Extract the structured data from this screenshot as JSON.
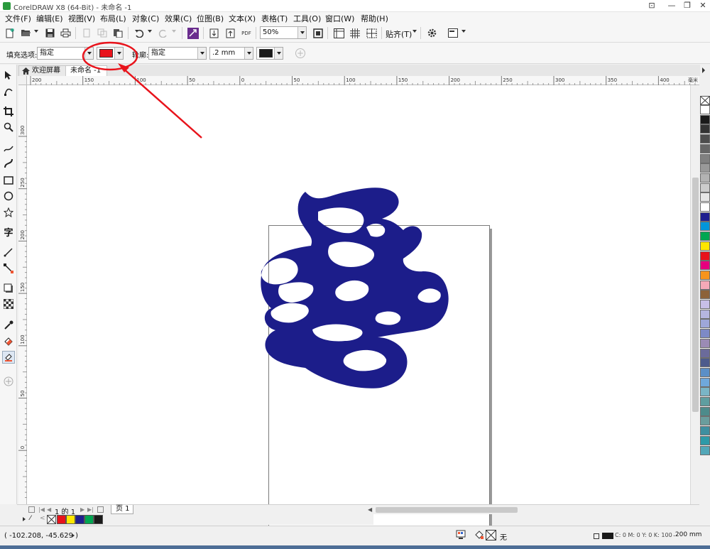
{
  "window": {
    "title": "CorelDRAW X8 (64-Bit) - 未命名 -1",
    "controls": [
      "minimize",
      "restore",
      "close"
    ]
  },
  "menubar": {
    "items": [
      "文件(F)",
      "编辑(E)",
      "视图(V)",
      "布局(L)",
      "对象(C)",
      "效果(C)",
      "位图(B)",
      "文本(X)",
      "表格(T)",
      "工具(O)",
      "窗口(W)",
      "帮助(H)"
    ]
  },
  "toolbar": {
    "zoom_value": "50%",
    "snap_label": "贴齐(T)",
    "pdf_label": "PDF"
  },
  "propbar": {
    "fill_label": "填充选项:",
    "fill_value": "指定",
    "fill_color": "#e8131b",
    "outline_label": "轮廓:",
    "outline_value": "指定",
    "outline_width": ".2 mm",
    "outline_color": "#1a1a1a"
  },
  "tabs": {
    "welcome": "欢迎屏幕",
    "document": "未命名 -1"
  },
  "ruler": {
    "h_ticks": [
      "200",
      "150",
      "100",
      "50",
      "0",
      "50",
      "100",
      "150",
      "200",
      "250",
      "300",
      "350",
      "400"
    ],
    "unit": "毫米",
    "v_ticks": [
      "300",
      "250",
      "200",
      "150",
      "100",
      "50",
      "0"
    ]
  },
  "artwork": {
    "shape_color": "#1c1d8a"
  },
  "palette": {
    "colors": [
      "#ffffff",
      "#1a1a1a",
      "#333333",
      "#4d4d4d",
      "#666666",
      "#808080",
      "#999999",
      "#b3b3b3",
      "#cccccc",
      "#e6e6e6",
      "#ffffff",
      "#1f1f8f",
      "#0095d9",
      "#00a651",
      "#ffe600",
      "#e8131b",
      "#e6007e",
      "#f7941d",
      "#f5a9b8",
      "#8c6239",
      "#c8bfe7",
      "#b5b5e0",
      "#9ea7d9",
      "#7d8ac6",
      "#9b8bb5",
      "#6b6b9b",
      "#4d5b8c",
      "#5b8fc7",
      "#6fa8dc",
      "#7ab5c6",
      "#5f9ea0",
      "#4d8b8b",
      "#6a9d9d",
      "#3f8fa0",
      "#2e9aa8",
      "#52a7b8"
    ]
  },
  "pagenav": {
    "page_info": "1 的 1",
    "page_tab": "页 1"
  },
  "docpalette": {
    "colors": [
      "#e8131b",
      "#ffe600",
      "#1f1f8f",
      "#00a651",
      "#1a1a1a"
    ]
  },
  "statusbar": {
    "coordinates": "( -102.208, -45.629 )",
    "fill_none": "无",
    "outline_info": "C: 0 M: 0 Y: 0 K: 100",
    "outline_width": ".200 mm"
  },
  "annotation": {
    "color": "#e8131b"
  }
}
